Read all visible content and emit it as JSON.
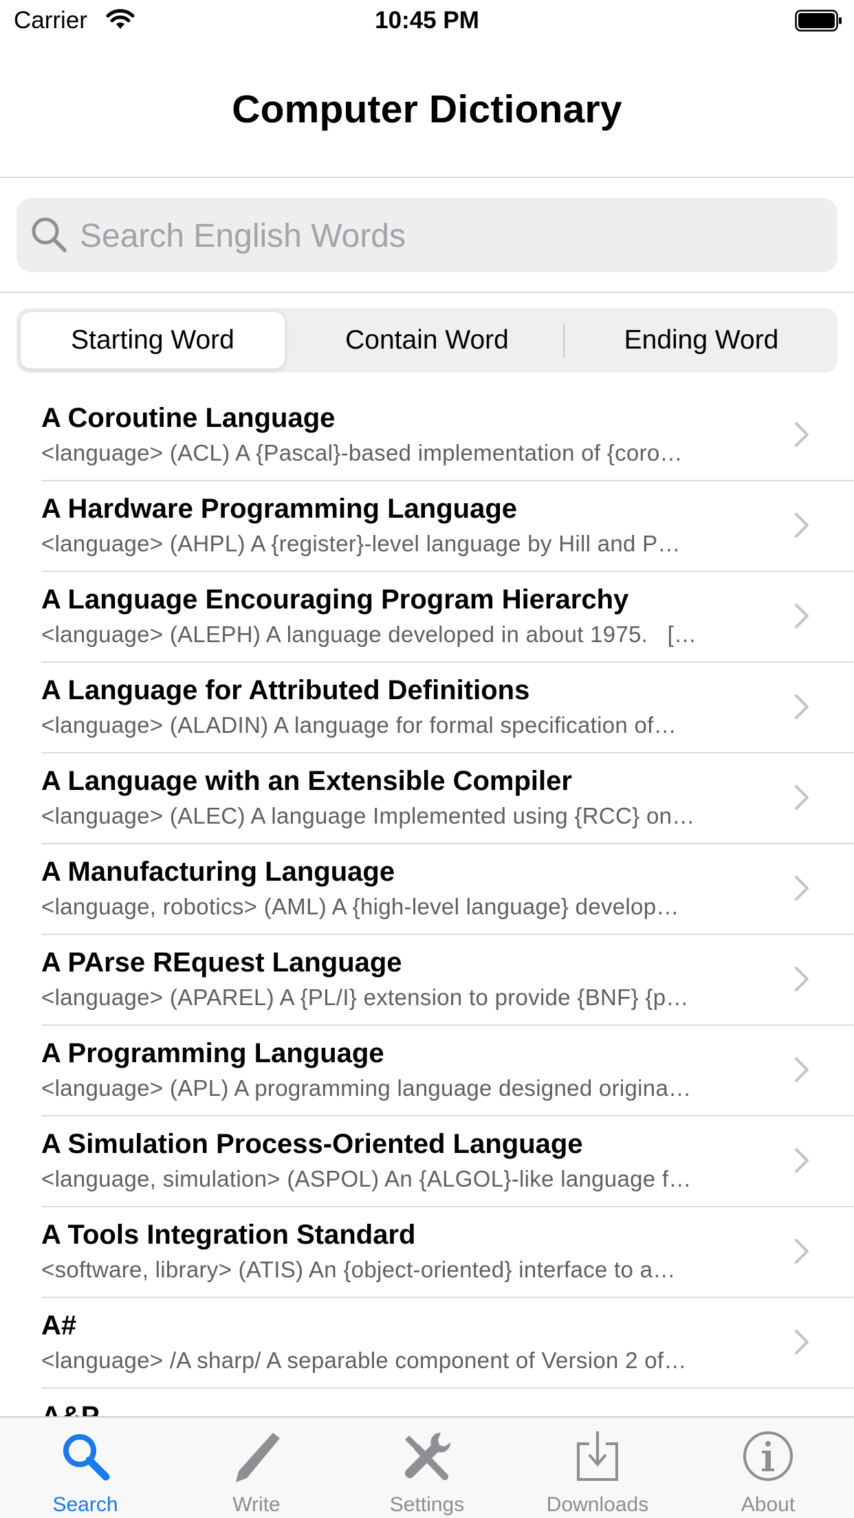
{
  "status_bar": {
    "carrier": "Carrier",
    "time": "10:45 PM"
  },
  "nav": {
    "title": "Computer Dictionary"
  },
  "search": {
    "placeholder": "Search English Words",
    "value": ""
  },
  "segments": [
    {
      "label": "Starting Word",
      "selected": true
    },
    {
      "label": "Contain Word",
      "selected": false
    },
    {
      "label": "Ending Word",
      "selected": false
    }
  ],
  "entries": [
    {
      "title": "A Coroutine Language",
      "subtitle": "<language> (ACL) A {Pascal}-based implementation of {coro…"
    },
    {
      "title": "A Hardware Programming Language",
      "subtitle": "<language> (AHPL) A {register}-level language by Hill and P…"
    },
    {
      "title": "A Language Encouraging Program Hierarchy",
      "subtitle": "<language> (ALEPH) A language developed in about 1975.   […"
    },
    {
      "title": "A Language for Attributed Definitions",
      "subtitle": "<language> (ALADIN) A language for formal specification of…"
    },
    {
      "title": "A Language with an Extensible Compiler",
      "subtitle": "<language> (ALEC) A language Implemented using {RCC} on…"
    },
    {
      "title": "A Manufacturing Language",
      "subtitle": "<language, robotics> (AML) A {high-level language} develop…"
    },
    {
      "title": "A PArse REquest Language",
      "subtitle": "<language> (APAREL) A {PL/I} extension to provide {BNF} {p…"
    },
    {
      "title": "A Programming Language",
      "subtitle": "<language> (APL) A programming language designed origina…"
    },
    {
      "title": "A Simulation Process-Oriented Language",
      "subtitle": "<language, simulation> (ASPOL) An {ALGOL}-like language f…"
    },
    {
      "title": "A Tools Integration Standard",
      "subtitle": "<software, library> (ATIS) An {object-oriented} interface to a…"
    },
    {
      "title": "A#",
      "subtitle": "<language> /A sharp/ A separable component of Version 2 of…"
    },
    {
      "title": "A&P",
      "subtitle": ""
    }
  ],
  "tabs": [
    {
      "label": "Search",
      "icon": "search-icon",
      "active": true
    },
    {
      "label": "Write",
      "icon": "pencil-icon",
      "active": false
    },
    {
      "label": "Settings",
      "icon": "tools-icon",
      "active": false
    },
    {
      "label": "Downloads",
      "icon": "download-tray-icon",
      "active": false
    },
    {
      "label": "About",
      "icon": "info-icon",
      "active": false
    }
  ],
  "colors": {
    "accent": "#1a7ae8",
    "inactive": "#8e8e93"
  }
}
